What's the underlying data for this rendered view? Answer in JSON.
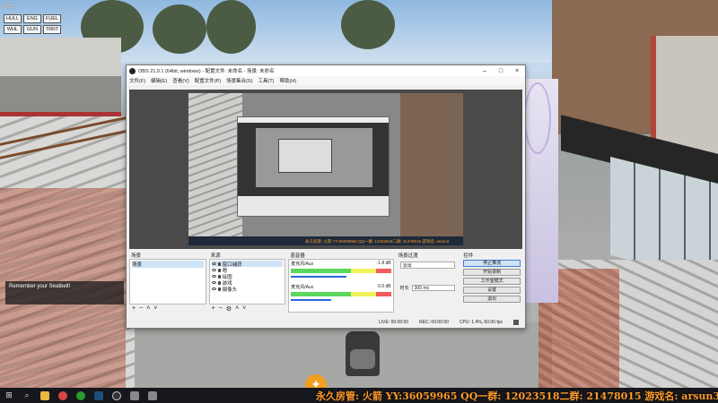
{
  "hud": {
    "top_text": "< Mo",
    "keys": [
      "HULL",
      "ENG",
      "FUEL",
      "WHL",
      "GUN",
      "TRRT"
    ],
    "hint": "Remember your Seatbelt!"
  },
  "obs": {
    "title": "OBS 21.0.1 (64bit, windows) - 配置文件: 未命名 - 场景: 未命名",
    "menu": [
      "文件(F)",
      "编辑(E)",
      "查看(V)",
      "配置文件(P)",
      "场景集合(S)",
      "工具(T)",
      "帮助(H)"
    ],
    "preview_caption": "永久房管: 火箭 YY:36059965 QQ一群: 12023518二群: 21478015 游戏名: arsun3",
    "docks": {
      "scenes": {
        "title": "场景",
        "items": [
          "场景"
        ]
      },
      "sources": {
        "title": "来源",
        "items": [
          "窗口捕获",
          "嗯",
          "绘图",
          "游戏",
          "摄像头"
        ]
      },
      "mixer": {
        "title": "混音器",
        "channels": [
          {
            "name": "麦克风/Aux",
            "db": "-1.8 dB",
            "level": 0.62
          },
          {
            "name": "麦克风/Aux",
            "db": "0.0 dB",
            "level": 0.45
          }
        ]
      },
      "transitions": {
        "title": "场景过渡",
        "selected": "淡出",
        "duration_label": "时长",
        "duration": "300 ms"
      },
      "controls": {
        "title": "控件",
        "buttons": [
          "停止推流",
          "开始录制",
          "工作室模式",
          "设置",
          "退出"
        ]
      }
    },
    "status": {
      "live": "LIVE: 00:00:00",
      "rec": "REC: 00:00:00",
      "cpu": "CPU: 1.4%, 60.00 fps"
    }
  },
  "taskbar": {
    "icons": [
      "windows-icon",
      "search-icon",
      "folder-icon",
      "chrome-icon",
      "xbox-icon",
      "steam-icon",
      "obs-icon",
      "monitor-icon",
      "monitor-icon"
    ],
    "ticker": "永久房管: 火箭 YY:36059965 QQ一群: 12023518二群: 21478015 游戏名: arsun3"
  },
  "colors": {
    "ticker": "#ff9b2a",
    "accent": "#3d7bd4"
  }
}
